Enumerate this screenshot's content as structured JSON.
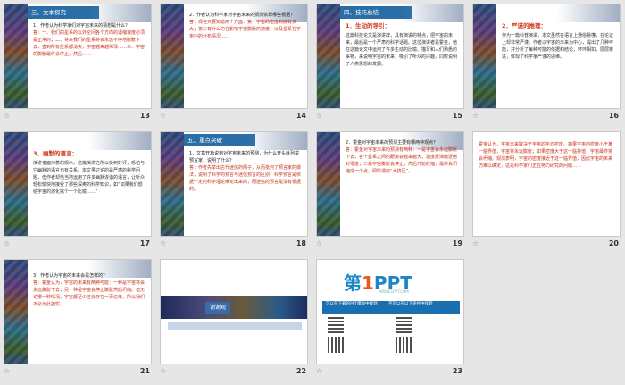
{
  "slides": [
    {
      "number": "13",
      "section": "三、文本探究",
      "question": "1．作者认为科学家们对宇宙未来的猜想是什么？",
      "answer": "答：一、我们的星系的以外空间各个方向的退缩速度必须是正常的；二、将来我们的星系将会永远不停地膨胀下去，直到所有星系都消失，宇宙越来越稀薄……三、宇宙的膨胀最终会停止，然后……"
    },
    {
      "number": "14",
      "section": "",
      "question": "2．作者认为科学家对宇宙未来的猜测依靠哪些根据？",
      "answer": "答：现在只要知道两个方面：第一宇宙的密度到底有多大；第二有什么力在影响宇宙膨胀的速度，以及星系在宇宙中的分布情况……"
    },
    {
      "number": "15",
      "section": "四、技巧总结",
      "heading": "1．生动的导引：",
      "body": "这篇科技论文是演讲辞，具有演讲的特点，把宇宙的未来，最后是一个严肃的科学话题。这位演讲者是霍金，他在这篇论文中运用了许多生动的比喻、描写和人们熟悉的事物，来说明宇宙的未来，吸引了听众的兴趣，同时说明了人类思想的发展。"
    },
    {
      "number": "16",
      "section": "",
      "heading": "2．严谨的推理：",
      "body": "作为一篇科普演讲，本文虽然在语言上通俗易懂，在论证上却非常严谨。作者以宇宙的未来为中心，提出了几种可能，并分析了每种可能的依据和结论，环环相扣，层层推进，体现了科学家严谨的思维。"
    },
    {
      "number": "17",
      "section": "",
      "heading": "3．幽默的语言：",
      "body": "演讲者面对着的观众，这篇演讲之所以受到好评，恐怕与它幽默的语言也有关系。本文虽讨论的是严肃的科学问题，但作者却恰当地运用了许多幽默诙谐的语言，让听众轻松愉快地接受了那些深奥的科学知识，如“如果我们想给宇宙的演化找个一个比喻……”"
    },
    {
      "number": "18",
      "section": "五、重点突破",
      "question": "1．文章开篇说到对宇宙未来的预测，为什么开头就列举预言家，说明了什么？",
      "answer": "答：作者先举出古代迷信的例子，从而批判了预言家的做法，说明了科学的预言与迷信预言的区别：科学预言是依据一定的科学理论推论出来的，而迷信的预言是没有根据的。"
    },
    {
      "number": "19",
      "section": "",
      "question": "2．霍金对宇宙未来的预测主要有哪两种观点？",
      "answer": "答：霍金对宇宙未来的预测有两种：一是宇宙会永远膨胀下去，各个星系之间的距离会越来越大，温度逐渐趋近绝对零度；二是宇宙膨胀会停止，然后开始收缩，最终会坍缩成一个点，即所谓的“大挤压”。"
    },
    {
      "number": "20",
      "section": "",
      "body": "霍金认为，宇宙未来取决于宇宙的平均密度。如果宇宙的密度小于某一临界值，宇宙将永远膨胀；如果密度大于这一临界值，宇宙最终将会坍缩。观测表明，宇宙的密度接近于这一临界值，因此宇宙的未来仍难以确定，这是科学家们正在努力研究的问题……"
    },
    {
      "number": "21",
      "section": "",
      "question": "3．作者认为宇宙的未来会是怎样的？",
      "answer": "答：霍金认为，宇宙的未来有两种可能：一种是宇宙将会永远膨胀下去；另一种是宇宙会停止膨胀然后坍缩。但无论哪一种情况，宇宙都至少还会存在一百亿年，所以我们不必为此担忧。"
    },
    {
      "number": "22",
      "thanks": "谢谢观"
    },
    {
      "number": "23",
      "logo_main": "第",
      "logo_one": "1",
      "logo_rest": "PPT",
      "logo_sub": "WWW.1PPT.COM",
      "bar_left": "可以在下载的PPT模板中找到",
      "bar_right": "不可以在以下途径中找到"
    }
  ]
}
